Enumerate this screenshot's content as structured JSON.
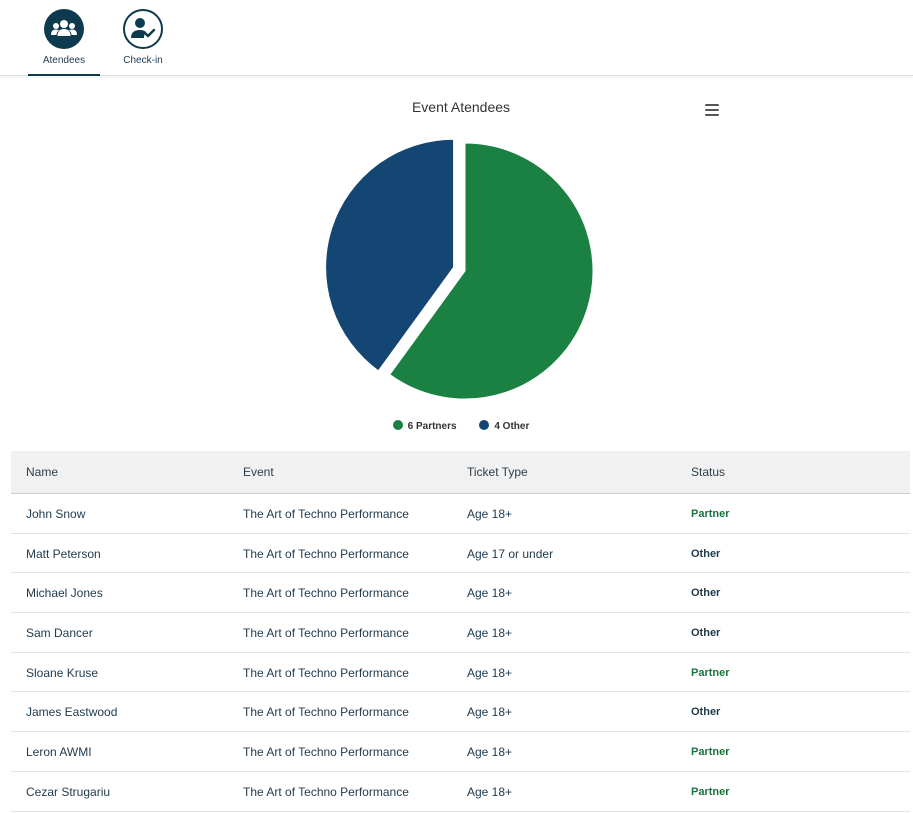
{
  "nav": {
    "items": [
      {
        "label": "Atendees",
        "icon": "users-icon",
        "active": true
      },
      {
        "label": "Check-in",
        "icon": "user-check-icon",
        "active": false
      }
    ]
  },
  "chart_data": {
    "type": "pie",
    "title": "Event Atendees",
    "categories": [
      "Partners",
      "Other"
    ],
    "values": [
      6,
      4
    ],
    "legend_labels": [
      "6 Partners",
      "4 Other"
    ],
    "colors": [
      "#1a8142",
      "#144673"
    ],
    "legend_placement": "bottom"
  },
  "table": {
    "headers": {
      "name": "Name",
      "event": "Event",
      "ticket": "Ticket Type",
      "status": "Status"
    },
    "rows": [
      {
        "name": "John Snow",
        "event": "The Art of Techno Performance",
        "ticket": "Age 18+",
        "status": "Partner"
      },
      {
        "name": "Matt Peterson",
        "event": "The Art of Techno Performance",
        "ticket": "Age 17 or under",
        "status": "Other"
      },
      {
        "name": "Michael Jones",
        "event": "The Art of Techno Performance",
        "ticket": "Age 18+",
        "status": "Other"
      },
      {
        "name": "Sam Dancer",
        "event": "The Art of Techno Performance",
        "ticket": "Age 18+",
        "status": "Other"
      },
      {
        "name": "Sloane Kruse",
        "event": "The Art of Techno Performance",
        "ticket": "Age 18+",
        "status": "Partner"
      },
      {
        "name": "James Eastwood",
        "event": "The Art of Techno Performance",
        "ticket": "Age 18+",
        "status": "Other"
      },
      {
        "name": "Leron AWMI",
        "event": "The Art of Techno Performance",
        "ticket": "Age 18+",
        "status": "Partner"
      },
      {
        "name": "Cezar Strugariu",
        "event": "The Art of Techno Performance",
        "ticket": "Age 18+",
        "status": "Partner"
      }
    ]
  },
  "colors": {
    "partner_status": "#1a7340",
    "other_status": "#1f3a4d",
    "nav_accent": "#0d3a4e"
  }
}
